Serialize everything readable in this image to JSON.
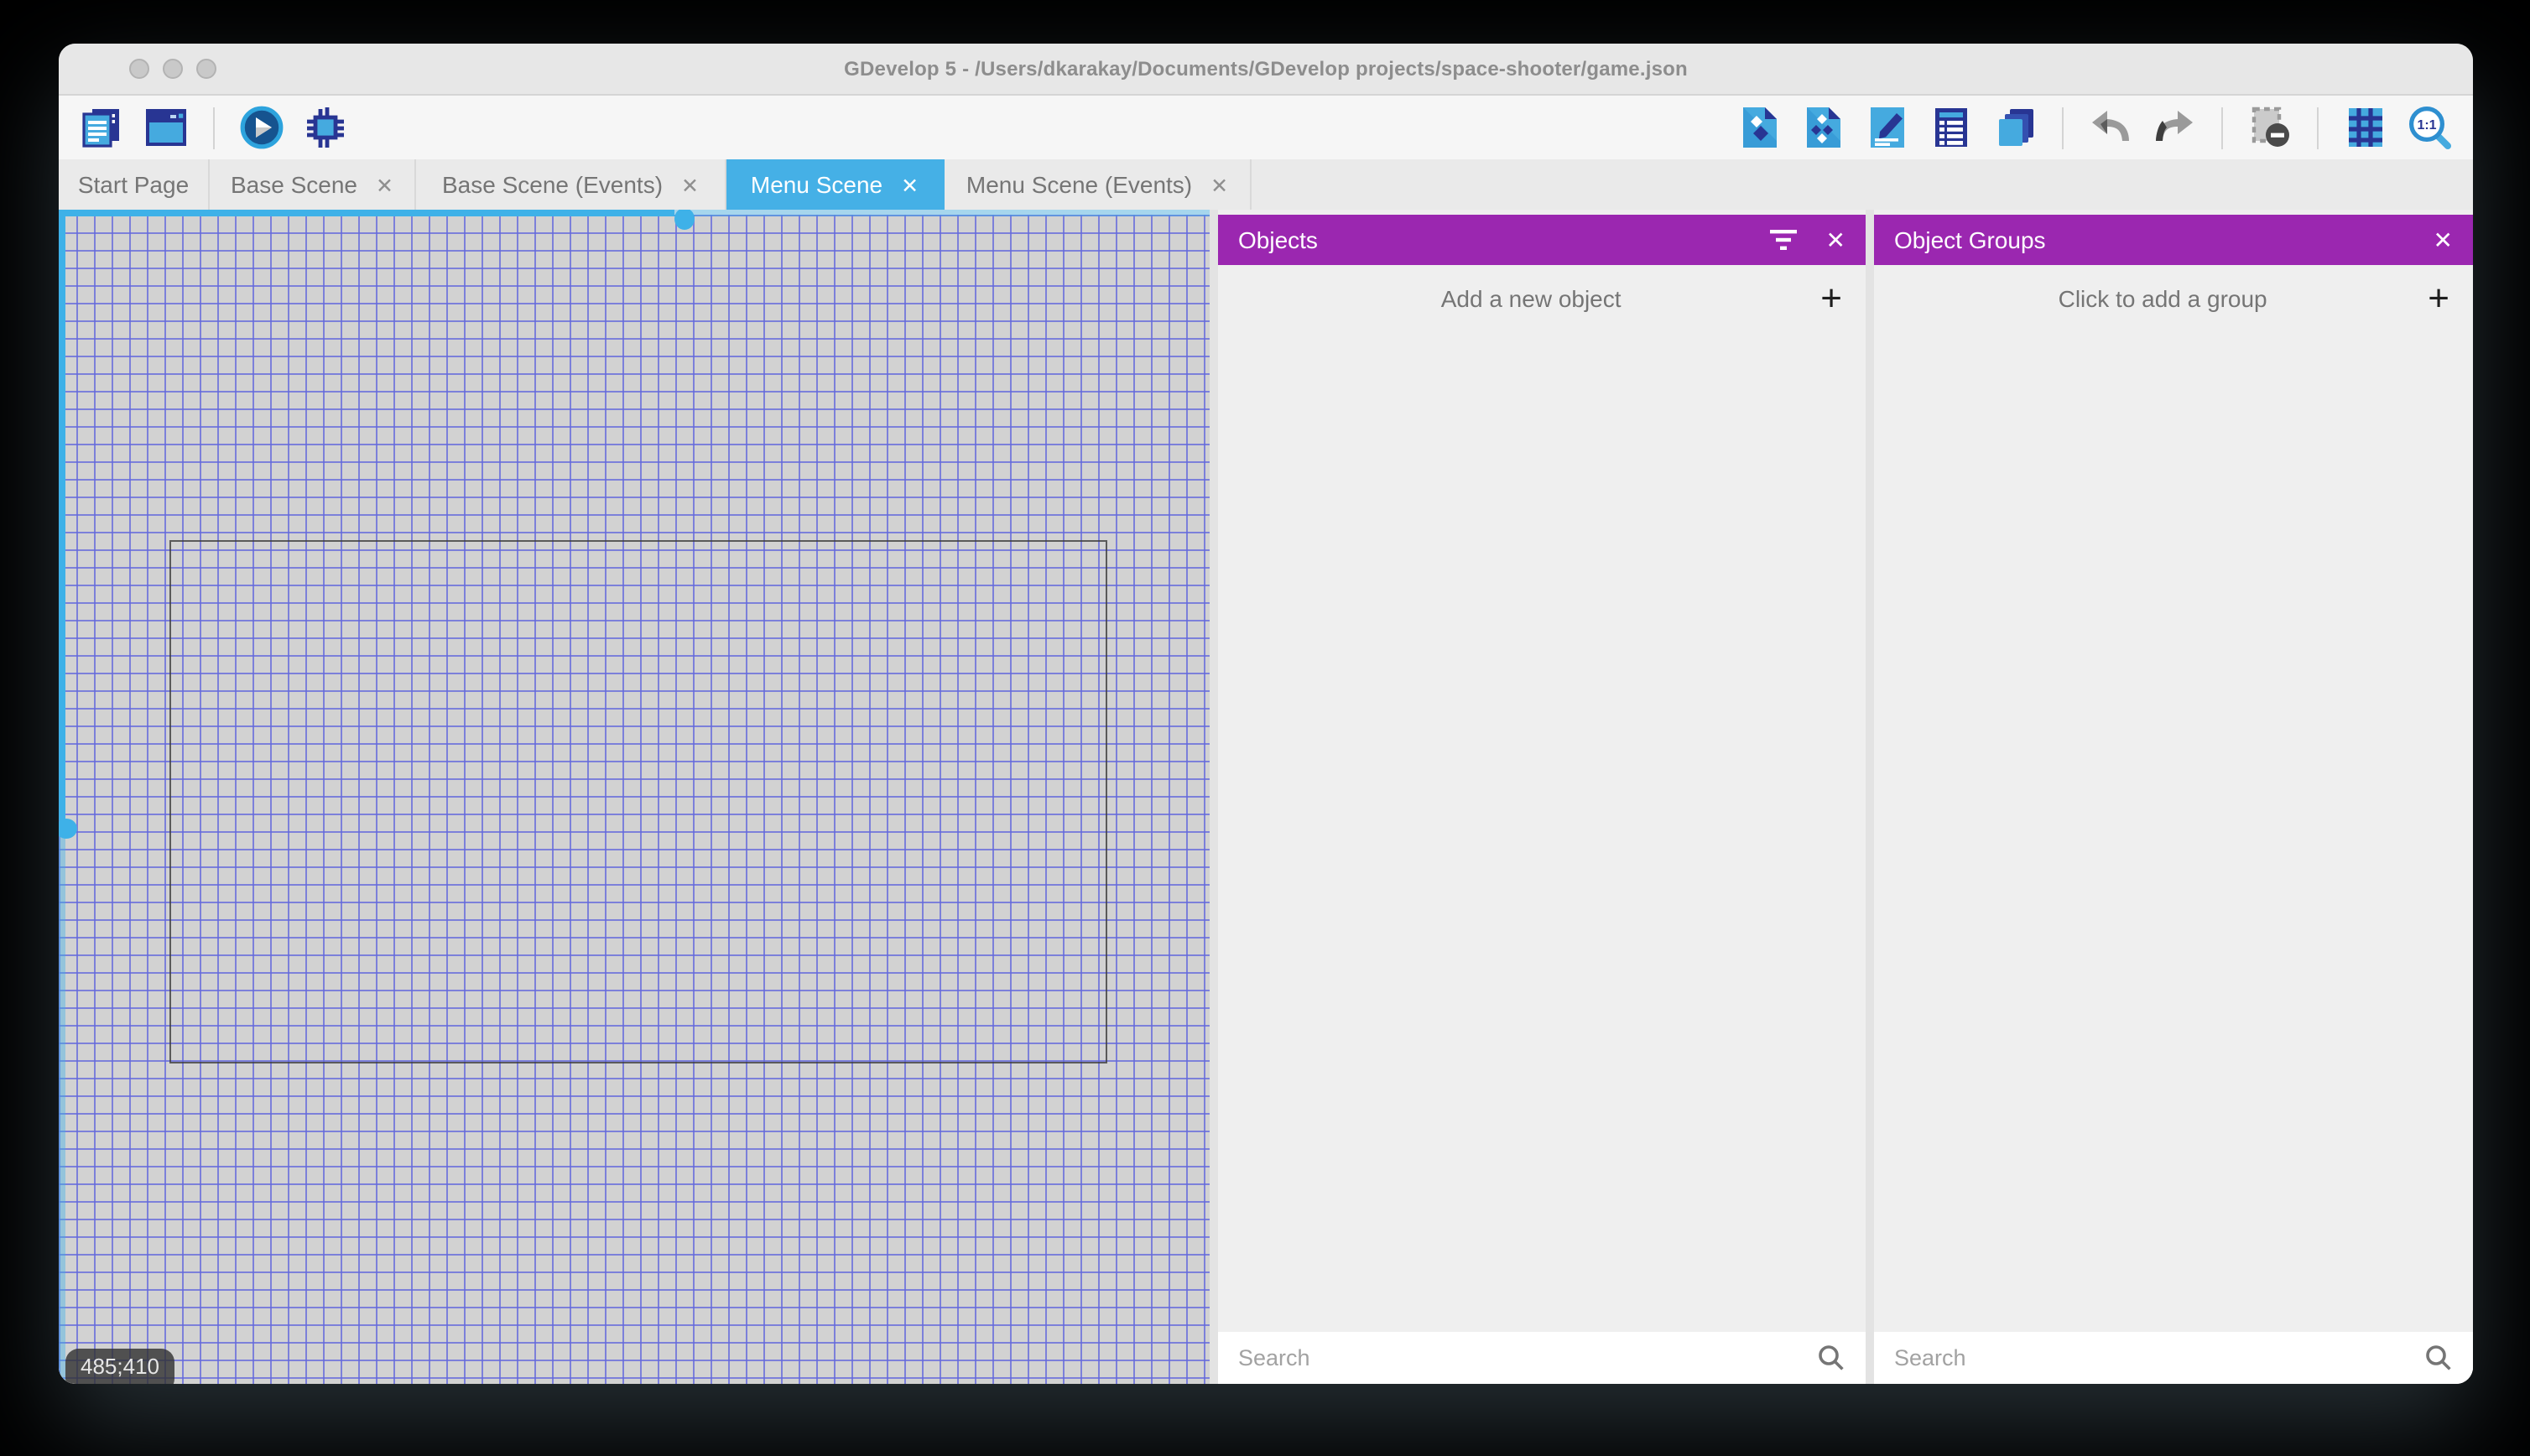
{
  "window": {
    "title": "GDevelop 5 - /Users/dkarakay/Documents/GDevelop projects/space-shooter/game.json"
  },
  "toolbar": {
    "left_icons": [
      "project-manager-icon",
      "window-icon",
      "play-icon",
      "debug-icon"
    ],
    "right_icons": [
      "objects-editor-icon",
      "object-groups-editor-icon",
      "properties-icon",
      "instances-list-icon",
      "layers-icon",
      "undo-icon",
      "redo-icon",
      "window-mask-icon",
      "grid-icon",
      "zoom-1-1-icon"
    ]
  },
  "tabs": [
    {
      "label": "Start Page",
      "closable": false,
      "active": false
    },
    {
      "label": "Base Scene",
      "closable": true,
      "active": false
    },
    {
      "label": "Base Scene (Events)",
      "closable": true,
      "active": false
    },
    {
      "label": "Menu Scene",
      "closable": true,
      "active": true
    },
    {
      "label": "Menu Scene (Events)",
      "closable": true,
      "active": false
    }
  ],
  "canvas": {
    "coordinates_badge": "485;410"
  },
  "objects_panel": {
    "title": "Objects",
    "icons": [
      "filter-icon",
      "close-icon"
    ],
    "add_label": "Add a new object",
    "add_button": "+",
    "search_placeholder": "Search"
  },
  "object_groups_panel": {
    "title": "Object Groups",
    "icons": [
      "close-icon"
    ],
    "add_label": "Click to add a group",
    "add_button": "+",
    "search_placeholder": "Search"
  },
  "glyphs": {
    "close": "✕"
  },
  "colors": {
    "accent_blue": "#45b0e6",
    "scrollbar_blue": "#3eb1e8",
    "panel_purple": "#9b27b0",
    "icon_navy": "#283593",
    "icon_blue": "#45aadf",
    "grid_line": "#6469dc",
    "grid_background": "#d2d2d2",
    "titlebar_gray": "#e7e7e7"
  }
}
